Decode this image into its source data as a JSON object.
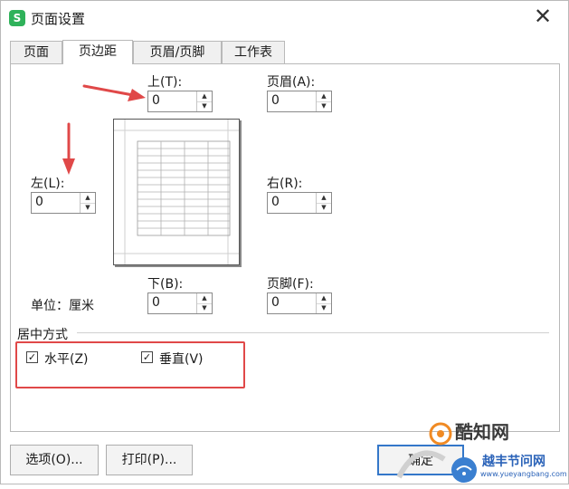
{
  "window": {
    "title": "页面设置",
    "app_icon": "S",
    "close_glyph": "✕"
  },
  "tabs": [
    {
      "label": "页面",
      "active": false
    },
    {
      "label": "页边距",
      "active": true
    },
    {
      "label": "页眉/页脚",
      "active": false
    },
    {
      "label": "工作表",
      "active": false
    }
  ],
  "margins": {
    "top": {
      "label": "上(T):",
      "value": "0"
    },
    "header": {
      "label": "页眉(A):",
      "value": "0"
    },
    "left": {
      "label": "左(L):",
      "value": "0"
    },
    "right": {
      "label": "右(R):",
      "value": "0"
    },
    "bottom": {
      "label": "下(B):",
      "value": "0"
    },
    "footer": {
      "label": "页脚(F):",
      "value": "0"
    },
    "unit": "单位：厘米"
  },
  "centering": {
    "label": "居中方式",
    "horizontal": {
      "label": "水平(Z)",
      "checked": true
    },
    "vertical": {
      "label": "垂直(V)",
      "checked": true
    }
  },
  "buttons": {
    "options": "选项(O)...",
    "print": "打印(P)...",
    "ok": "确定"
  },
  "watermark": {
    "brand_line1": "酷知网",
    "brand_line2": "越丰节问网",
    "url": "www.yueyangbang.com"
  },
  "colors": {
    "accent_red": "#e04848",
    "wps_green": "#2fb25a",
    "primary_blue": "#3477c9",
    "watermark_orange": "#f08a24"
  }
}
